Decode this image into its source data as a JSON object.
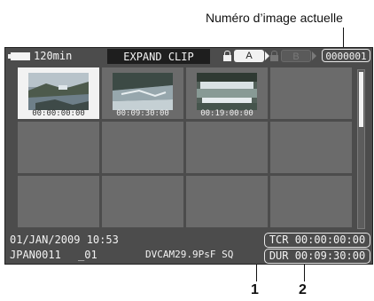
{
  "annotations": {
    "current_image_label": "Numéro d’image actuelle",
    "callout_1": "1",
    "callout_2": "2"
  },
  "header": {
    "battery_remaining": "120min",
    "screen_title": "EXPAND CLIP",
    "slot_a": "A",
    "slot_b": "B",
    "image_number": "0000001"
  },
  "thumbnails": [
    {
      "timecode": "00:00:00:00",
      "selected": true
    },
    {
      "timecode": "00:09:30:00",
      "selected": false
    },
    {
      "timecode": "00:19:00:00",
      "selected": false
    }
  ],
  "footer": {
    "datetime": "01/JAN/2009 10:53",
    "clip_name": "JPAN0011",
    "clip_suffix": "_01",
    "format": "DVCAM29.9PsF SQ",
    "tcr": "TCR 00:00:00:00",
    "dur": "DUR 00:09:30:00"
  },
  "colors": {
    "screen_bg": "#4c4c4c",
    "cell": "#6b6b6b",
    "selected": "#f2f2f2"
  }
}
